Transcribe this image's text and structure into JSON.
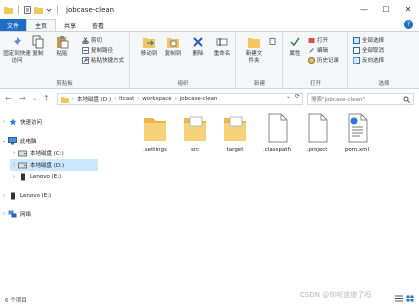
{
  "window": {
    "title": "jobcase-clean",
    "controls": {
      "minimize": "—",
      "maximize": "☐",
      "close": "✕"
    }
  },
  "ribbon_tabs": [
    "文件",
    "主页",
    "共享",
    "查看"
  ],
  "ribbon": {
    "clipboard": {
      "label": "剪贴板",
      "pin": "固定到快速访问",
      "copy": "复制",
      "paste": "粘贴",
      "cut": "剪切",
      "copy_path": "复制路径",
      "paste_shortcut": "粘贴快捷方式"
    },
    "organize": {
      "label": "组织",
      "move_to": "移动到",
      "copy_to": "复制到",
      "delete": "删除",
      "rename": "重命名"
    },
    "new": {
      "label": "新建",
      "new_folder": "新建文件夹"
    },
    "open": {
      "label": "打开",
      "properties": "属性",
      "open": "打开",
      "edit": "编辑",
      "history": "历史记录"
    },
    "select": {
      "label": "选择",
      "select_all": "全部选择",
      "select_none": "全部取消",
      "invert": "反向选择"
    }
  },
  "address": {
    "crumbs": [
      "本地磁盘 (D:)",
      "itcast",
      "workspace",
      "jobcase-clean"
    ],
    "search_placeholder": "搜索\"jobcase-clean\""
  },
  "nav": {
    "quick_access": "快速访问",
    "this_pc": "此电脑",
    "drive_c": "本地磁盘 (C:)",
    "drive_d": "本地磁盘 (D:)",
    "drive_e": "Lenovo (E:)",
    "drive_e2": "Lenovo (E:)",
    "network": "网络"
  },
  "files": [
    {
      "name": ".settings",
      "type": "folder"
    },
    {
      "name": "src",
      "type": "folder"
    },
    {
      "name": "target",
      "type": "folder"
    },
    {
      "name": ".classpath",
      "type": "file"
    },
    {
      "name": ".project",
      "type": "file"
    },
    {
      "name": "pom.xml",
      "type": "xml"
    }
  ],
  "status": {
    "count": "6 个项目"
  },
  "watermark": "CSDN @你听道狼了吗",
  "colors": {
    "accent": "#1e6fc4",
    "folder": "#f4c75e",
    "selected": "#cce8ff"
  }
}
